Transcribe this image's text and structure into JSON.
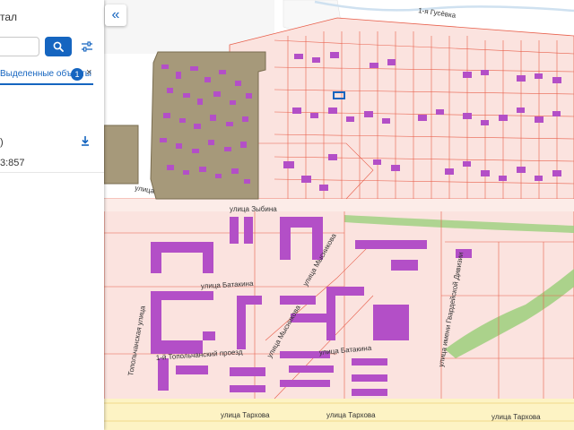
{
  "panel": {
    "portal_title": "тал",
    "search_placeholder": "",
    "tab_label": "Выделенные объекты",
    "tab_count": "1",
    "tab_close": "×",
    "item_text": ")",
    "item_number": "3:857"
  },
  "collapse_glyph": "«",
  "map": {
    "streets": {
      "gusevka": "1-я Гусёвка",
      "zubina": "улица Зыбина",
      "batakina_1": "улица Батакина",
      "batakina_2": "улица Батакина",
      "mysnikova_1": "улица Мысникова",
      "mysnikova_2": "улица Мысникова",
      "topolchanskaya": "Топольчанская улица",
      "topolchansky_proezd": "1-й Топольчанский проезд",
      "tarkhova_1": "улица Тархова",
      "tarkhova_2": "улица Тархова",
      "tarkhova_3": "улица Тархова",
      "gvardeyskaya": "улица имени Гвардейской Дивизии",
      "left_label": "улица"
    }
  },
  "colors": {
    "primary": "#1565c0",
    "parcel_fill": "#fbe3df",
    "parcel_stroke": "#e8604c",
    "building": "#b34fc7",
    "selected_fill": "#a6997a",
    "selected_stroke": "#7a6d50",
    "road": "#fdf3c4",
    "green": "#9ccf7d"
  }
}
